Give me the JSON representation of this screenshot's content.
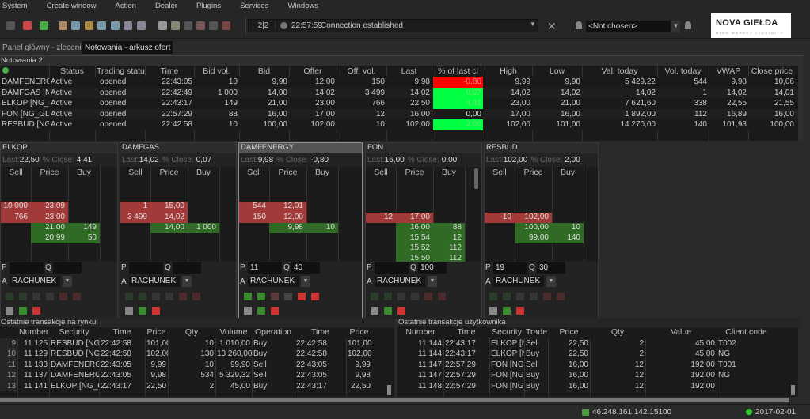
{
  "menu": [
    "System",
    "Create window",
    "Action",
    "Dealer",
    "Plugins",
    "Services",
    "Windows"
  ],
  "toolbar": {
    "counter": "2|2",
    "conn_time": "22:57:59",
    "conn_status": "Connection established",
    "user_select": "<Not chosen>",
    "logo_main": "NOVA GIEŁDA",
    "logo_sub": "HIGH MARKET LIQUIDITY"
  },
  "tabs": [
    {
      "label": "Panel główny - zlecenia",
      "active": false
    },
    {
      "label": "Notowania - arkusz ofert",
      "active": true
    }
  ],
  "quotes": {
    "title": "Notowania 2",
    "columns": [
      "",
      "Status",
      "Trading statu",
      "Time",
      "Bid vol.",
      "Bid",
      "Offer",
      "Off. vol.",
      "Last",
      "% of last cl",
      "High",
      "Low",
      "Val. today",
      "Vol. today",
      "VWAP",
      "Close price"
    ],
    "rows": [
      [
        "DAMFENERGY",
        "Active",
        "opened",
        "22:43:05",
        "10",
        "9,98",
        "12,00",
        "150",
        "9,98",
        "-0,80",
        "9,99",
        "9,98",
        "5 429,22",
        "544",
        "9,98",
        "10,06"
      ],
      [
        "DAMFGAS [NG",
        "Active",
        "opened",
        "22:42:49",
        "1 000",
        "14,00",
        "14,02",
        "3 499",
        "14,02",
        "0,07",
        "14,02",
        "14,02",
        "14,02",
        "1",
        "14,02",
        "14,01"
      ],
      [
        "ELKOP [NG_G",
        "Active",
        "opened",
        "22:43:17",
        "149",
        "21,00",
        "23,00",
        "766",
        "22,50",
        "4,41",
        "23,00",
        "21,00",
        "7 621,60",
        "338",
        "22,55",
        "21,55"
      ],
      [
        "FON [NG_GLO",
        "Active",
        "opened",
        "22:57:29",
        "88",
        "16,00",
        "17,00",
        "12",
        "16,00",
        "0,00",
        "17,00",
        "16,00",
        "1 892,00",
        "112",
        "16,89",
        "16,00"
      ],
      [
        "RESBUD [NG_",
        "Active",
        "opened",
        "22:42:58",
        "10",
        "100,00",
        "102,00",
        "10",
        "102,00",
        "2,00",
        "102,00",
        "101,00",
        "14 270,00",
        "140",
        "101,93",
        "100,00"
      ]
    ],
    "pct_colors": {
      "negative": "#ff0000",
      "positive": "#00ff40",
      "zero": "#1a1a1a"
    }
  },
  "books": [
    {
      "name": "ELKOP",
      "last_label": "Last:",
      "last": "22,50",
      "close_label": "% Close:",
      "pct": "4,41",
      "headers": [
        "Sell",
        "Price",
        "Buy"
      ],
      "sells": [
        [
          "10 000",
          "23,09"
        ],
        [
          "766",
          "23,00"
        ]
      ],
      "buys": [
        [
          "21,00",
          "149"
        ],
        [
          "20,99",
          "50"
        ]
      ],
      "p": "",
      "q": "",
      "account": "RACHUNEK",
      "selected": false
    },
    {
      "name": "DAMFGAS",
      "last_label": "Last:",
      "last": "14,02",
      "close_label": "% Close:",
      "pct": "0,07",
      "headers": [
        "Sell",
        "Price",
        "Buy"
      ],
      "sells": [
        [
          "1",
          "15,00"
        ],
        [
          "3 499",
          "14,02"
        ]
      ],
      "buys": [
        [
          "14,00",
          "1 000"
        ]
      ],
      "p": "",
      "q": "",
      "account": "RACHUNEK",
      "selected": false
    },
    {
      "name": "DAMFENERGY",
      "last_label": "Last:",
      "last": "9,98",
      "close_label": "% Close:",
      "pct": "-0,80",
      "headers": [
        "Sell",
        "Price",
        "Buy"
      ],
      "sells": [
        [
          "544",
          "12,01"
        ],
        [
          "150",
          "12,00"
        ]
      ],
      "buys": [
        [
          "9,98",
          "10"
        ]
      ],
      "p": "11",
      "q": "40",
      "account": "RACHUNEK",
      "selected": true
    },
    {
      "name": "FON",
      "last_label": "Last:",
      "last": "16,00",
      "close_label": "% Close:",
      "pct": "0,00",
      "headers": [
        "Sell",
        "Price",
        "Buy"
      ],
      "sells": [
        [
          "12",
          "17,00"
        ]
      ],
      "buys": [
        [
          "16,00",
          "88"
        ],
        [
          "15,54",
          "12"
        ],
        [
          "15,52",
          "112"
        ],
        [
          "15,50",
          "112"
        ]
      ],
      "p": "",
      "q": "100",
      "account": "RACHUNEK",
      "selected": false
    },
    {
      "name": "RESBUD",
      "last_label": "Last:",
      "last": "102,00",
      "close_label": "% Close:",
      "pct": "2,00",
      "headers": [
        "Sell",
        "Price",
        "Buy"
      ],
      "sells": [
        [
          "10",
          "102,00"
        ]
      ],
      "buys": [
        [
          "100,00",
          "10"
        ],
        [
          "99,00",
          "140"
        ]
      ],
      "p": "19",
      "q": "30",
      "account": "RACHUNEK",
      "selected": false
    }
  ],
  "market_trades": {
    "title": "Ostatnie transakcje na rynku",
    "columns": [
      "",
      "Number",
      "Security",
      "Time",
      "Price",
      "Qty",
      "Volume",
      "Operation",
      "Time",
      "Price"
    ],
    "rows": [
      [
        "9",
        "11 125",
        "RESBUD [NG_",
        "22:42:58",
        "101,00",
        "10",
        "1 010,00",
        "Buy",
        "22:42:58",
        "101,00"
      ],
      [
        "10",
        "11 129",
        "RESBUD [NG_",
        "22:42:58",
        "102,00",
        "130",
        "13 260,00",
        "Buy",
        "22:42:58",
        "102,00"
      ],
      [
        "11",
        "11 133",
        "DAMFENERG",
        "22:43:05",
        "9,99",
        "10",
        "99,90",
        "Sell",
        "22:43:05",
        "9,99"
      ],
      [
        "12",
        "11 137",
        "DAMFENERG",
        "22:43:05",
        "9,98",
        "534",
        "5 329,32",
        "Sell",
        "22:43:05",
        "9,98"
      ],
      [
        "13",
        "11 141",
        "ELKOP [NG_G",
        "22:43:17",
        "22,50",
        "2",
        "45,00",
        "Buy",
        "22:43:17",
        "22,50"
      ]
    ]
  },
  "user_trades": {
    "title": "Ostatnie transakcje użytkownika",
    "columns": [
      "Number",
      "Time",
      "Security",
      "Trade",
      "Price",
      "Qty",
      "Value",
      "Client code"
    ],
    "rows": [
      [
        "11 144",
        "22:43:17",
        "ELKOP [NG",
        "Sell",
        "22,50",
        "2",
        "45,00",
        "T002"
      ],
      [
        "11 144",
        "22:43:17",
        "ELKOP [NG",
        "Buy",
        "22,50",
        "2",
        "45,00",
        "NG"
      ],
      [
        "11 147",
        "22:57:29",
        "FON [NG_G",
        "Sell",
        "16,00",
        "12",
        "192,00",
        "T001"
      ],
      [
        "11 147",
        "22:57:29",
        "FON [NG_G",
        "Buy",
        "16,00",
        "12",
        "192,00",
        "NG"
      ],
      [
        "11 148",
        "22:57:29",
        "FON [NG_G",
        "Buy",
        "16,00",
        "12",
        "192,00",
        ""
      ]
    ]
  },
  "status": {
    "server": "46.248.161.142:15100",
    "date": "2017-02-01"
  }
}
